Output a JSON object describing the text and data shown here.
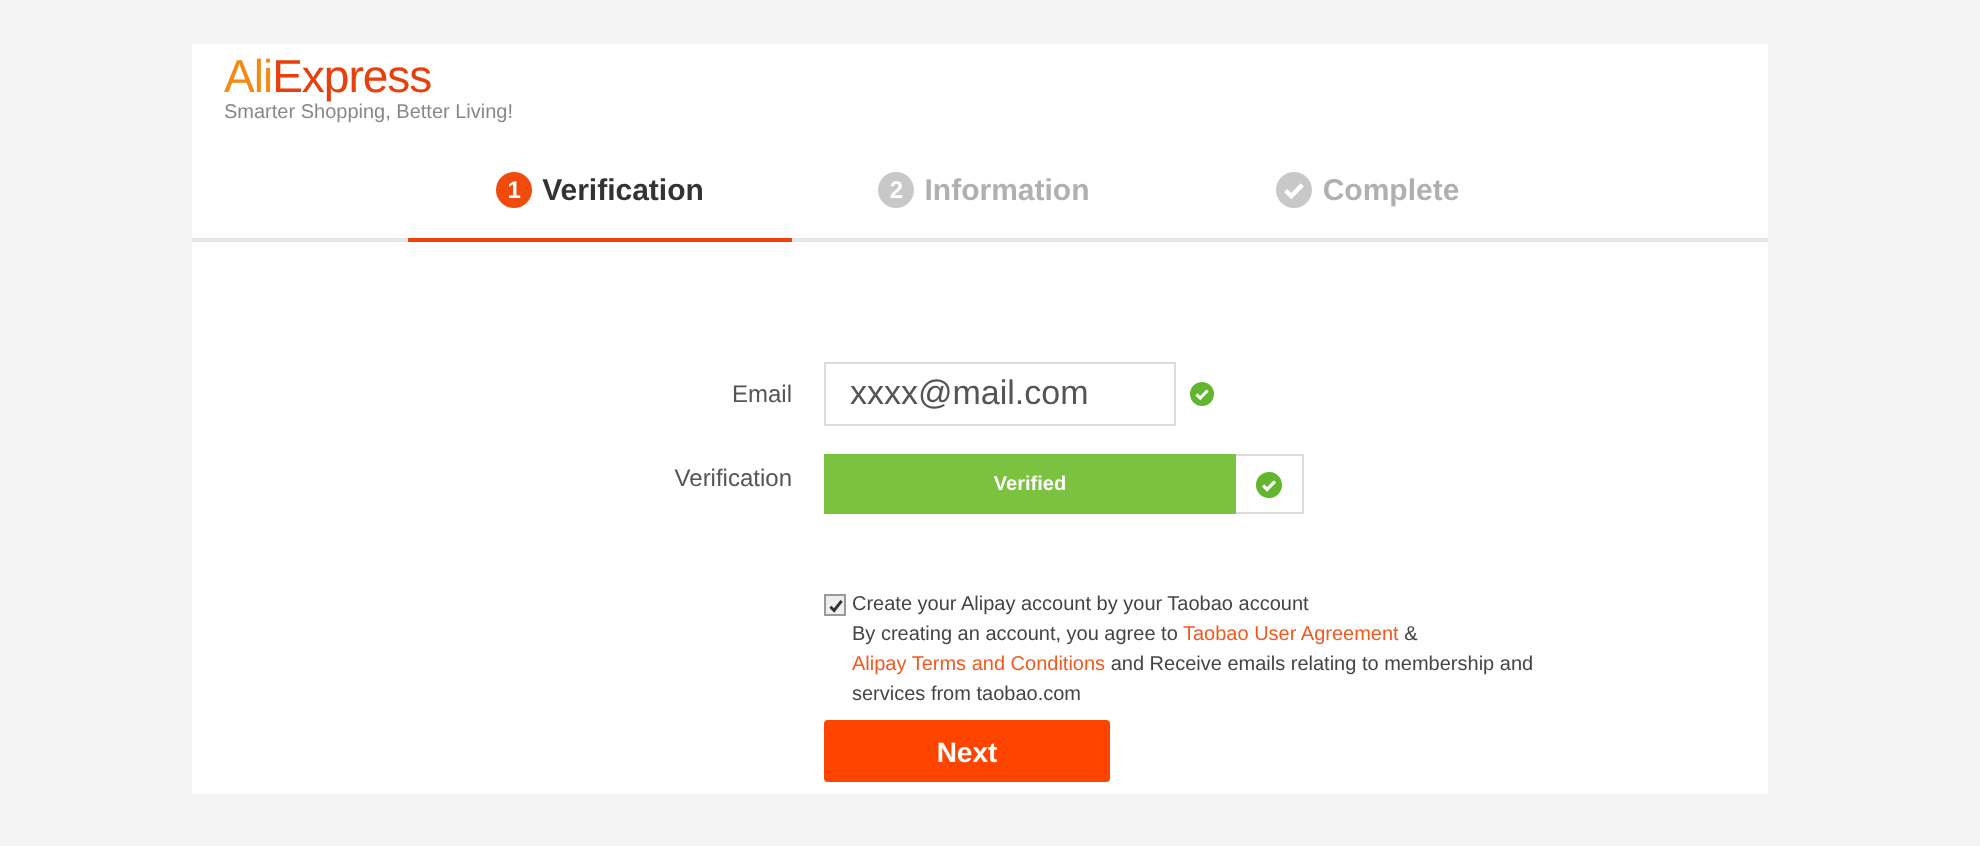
{
  "logo": {
    "first": "Ali",
    "second": "Express",
    "tagline": "Smarter Shopping, Better Living!"
  },
  "steps": [
    {
      "kind": "number",
      "marker": "1",
      "label": "Verification",
      "selected": true
    },
    {
      "kind": "number",
      "marker": "2",
      "label": "Information",
      "selected": false
    },
    {
      "kind": "check",
      "label": "Complete",
      "selected": false
    }
  ],
  "email": {
    "label": "Email",
    "value": "xxxx@mail.com",
    "valid": true
  },
  "verification": {
    "label": "Verification",
    "status": "Verified",
    "verified": true
  },
  "alipay": {
    "checked": true,
    "label": "Create your Alipay account by your Taobao account",
    "agreement": [
      {
        "kind": "text",
        "text": "By creating an account, you agree to "
      },
      {
        "kind": "link",
        "text": "Taobao User Agreement"
      },
      {
        "kind": "text",
        "text": " & "
      },
      {
        "kind": "link",
        "text": "Alipay Terms and Conditions"
      },
      {
        "kind": "text",
        "text": " and Receive emails relating to membership and services from taobao.com"
      }
    ]
  },
  "next_button": "Next"
}
